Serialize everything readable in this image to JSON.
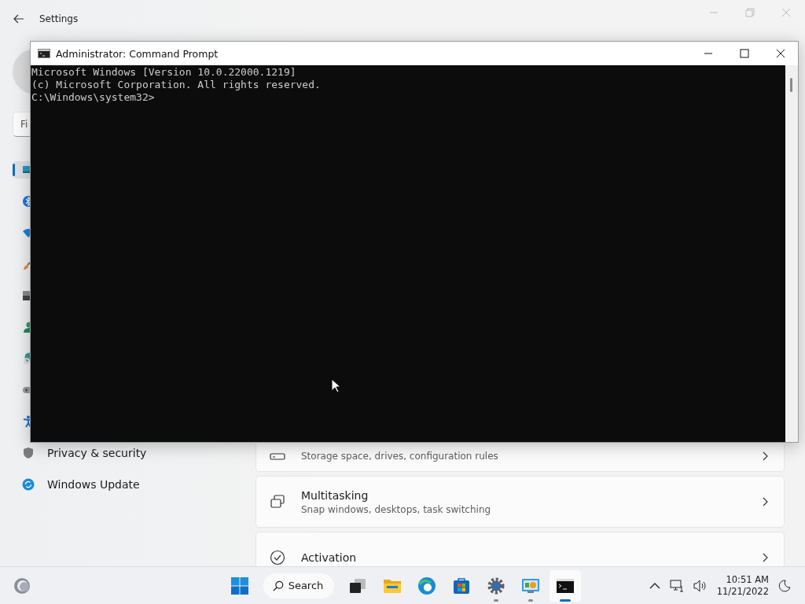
{
  "settings": {
    "title": "Settings",
    "search": {
      "placeholder": "Fi"
    },
    "nav_items": [
      {
        "kind": "system",
        "selected": true
      },
      {
        "kind": "bluetooth",
        "selected": false
      },
      {
        "kind": "network",
        "selected": false
      },
      {
        "kind": "personalization",
        "selected": false
      },
      {
        "kind": "apps",
        "selected": false
      },
      {
        "kind": "accounts",
        "selected": false
      },
      {
        "kind": "time",
        "selected": false
      },
      {
        "kind": "gaming",
        "selected": false
      },
      {
        "kind": "accessibility",
        "selected": false
      },
      {
        "kind": "privacy",
        "label": "Privacy & security",
        "selected": false
      },
      {
        "kind": "update",
        "label": "Windows Update",
        "selected": false
      }
    ],
    "cards": [
      {
        "kind": "storage",
        "description": "Storage space, drives, configuration rules"
      },
      {
        "kind": "multitasking",
        "title": "Multitasking",
        "description": "Snap windows, desktops, task switching"
      },
      {
        "kind": "activation",
        "title": "Activation"
      }
    ]
  },
  "console": {
    "title": "Administrator: Command Prompt",
    "lines": [
      "Microsoft Windows [Version 10.0.22000.1219]",
      "(c) Microsoft Corporation. All rights reserved.",
      "C:\\Windows\\system32>"
    ]
  },
  "taskbar": {
    "search_label": "Search",
    "apps": [
      {
        "kind": "taskview",
        "running": false,
        "active": false
      },
      {
        "kind": "explorer",
        "running": false,
        "active": false
      },
      {
        "kind": "edge",
        "running": false,
        "active": false
      },
      {
        "kind": "store",
        "running": false,
        "active": false
      },
      {
        "kind": "settings",
        "running": true,
        "active": false
      },
      {
        "kind": "controlpanel",
        "running": true,
        "active": false
      },
      {
        "kind": "terminal",
        "running": true,
        "active": true
      }
    ],
    "time": "10:51 AM",
    "date": "11/21/2022"
  }
}
